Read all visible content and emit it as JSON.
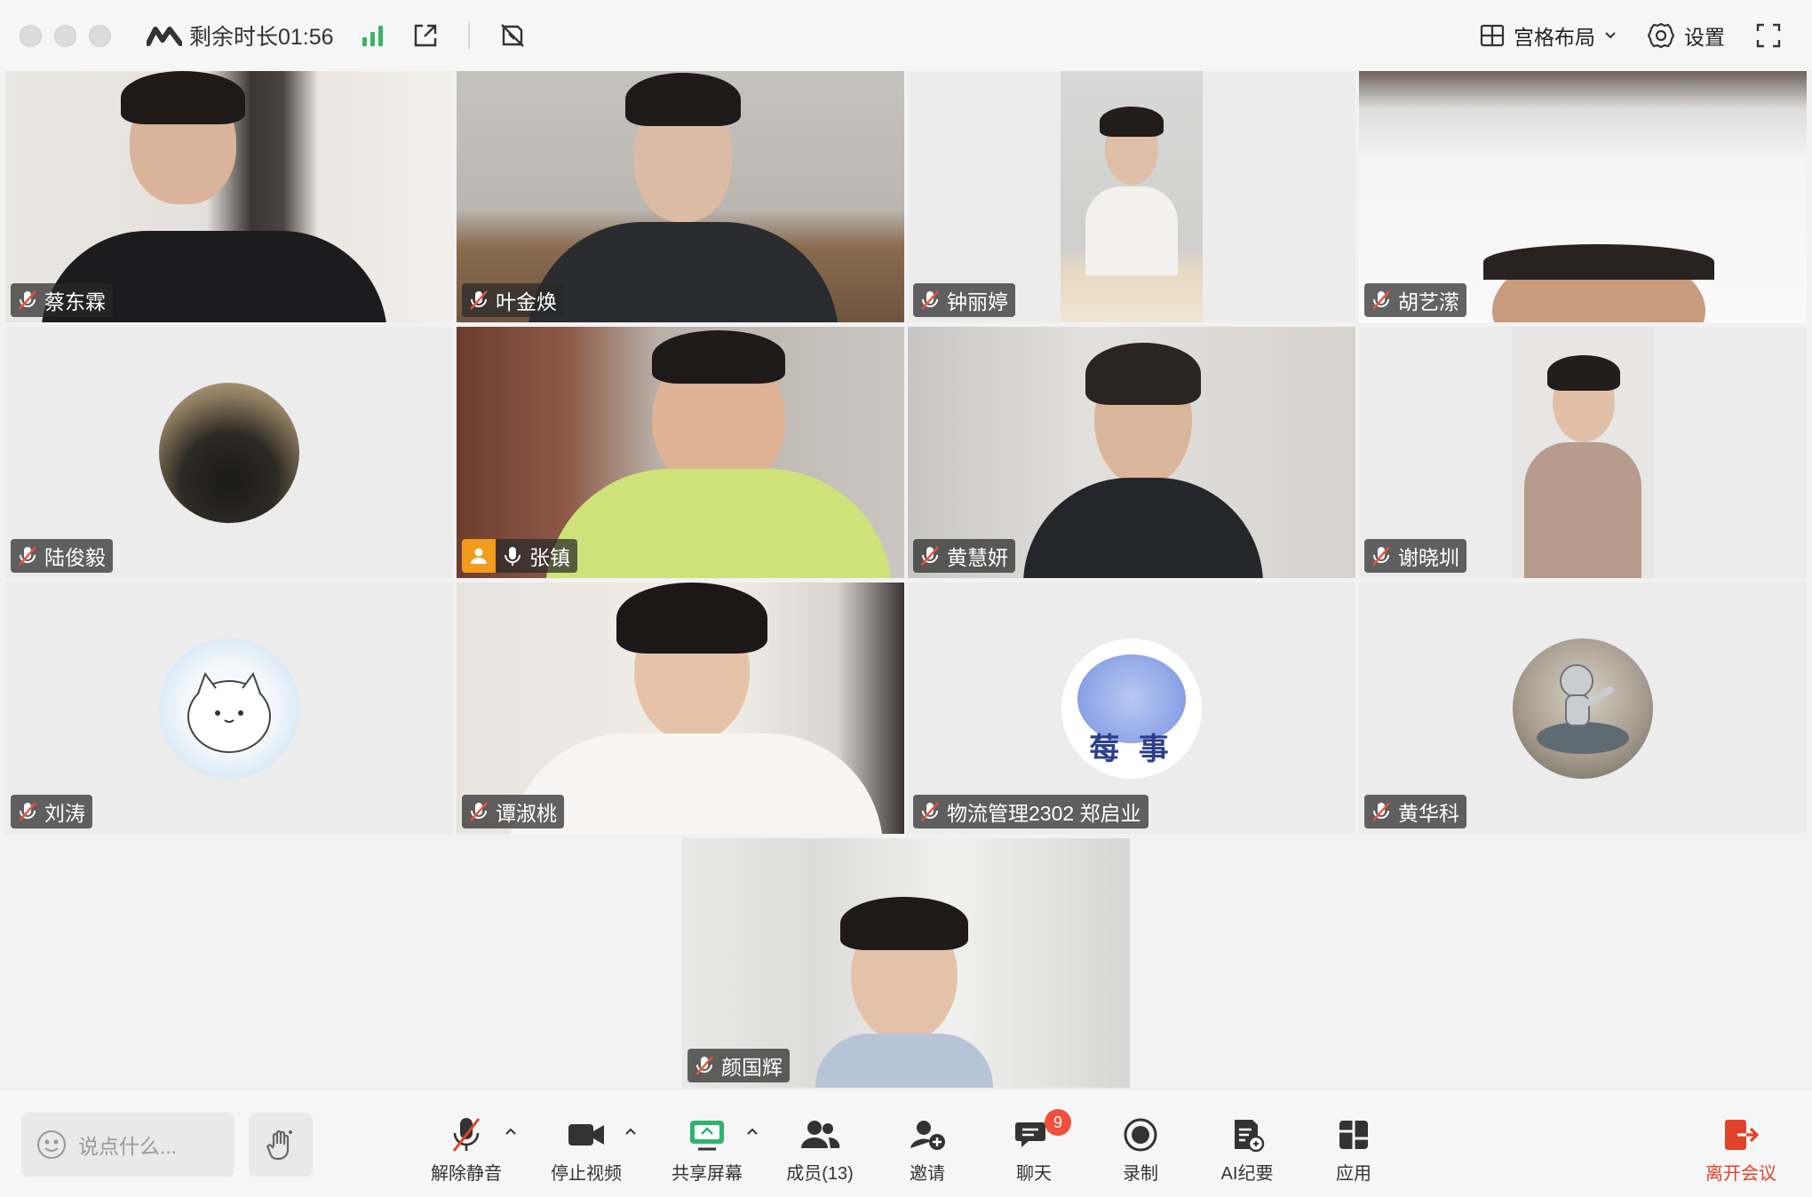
{
  "topbar": {
    "remaining_time": "剩余时长01:56",
    "layout_label": "宫格布局",
    "settings_label": "设置"
  },
  "participants": [
    {
      "name": "蔡东霖",
      "muted": true
    },
    {
      "name": "叶金焕",
      "muted": true
    },
    {
      "name": "钟丽婷",
      "muted": true
    },
    {
      "name": "胡艺潆",
      "muted": true
    },
    {
      "name": "陆俊毅",
      "muted": true
    },
    {
      "name": "张镇",
      "muted": false,
      "host": true
    },
    {
      "name": "黄慧妍",
      "muted": true
    },
    {
      "name": "谢晓圳",
      "muted": true
    },
    {
      "name": "刘涛",
      "muted": true
    },
    {
      "name": "谭淑桃",
      "muted": true
    },
    {
      "name": "物流管理2302 郑启业",
      "muted": true,
      "avatar_text": "莓 事"
    },
    {
      "name": "黄华科",
      "muted": true
    },
    {
      "name": "颜国辉",
      "muted": true
    }
  ],
  "bottombar": {
    "chat_placeholder": "说点什么...",
    "unmute_label": "解除静音",
    "stop_video_label": "停止视频",
    "share_screen_label": "共享屏幕",
    "members_label": "成员(13)",
    "invite_label": "邀请",
    "chat_label": "聊天",
    "chat_badge": "9",
    "record_label": "录制",
    "ai_minutes_label": "AI纪要",
    "apps_label": "应用",
    "leave_label": "离开会议"
  },
  "colors": {
    "signal": "#3cb36b",
    "leave": "#e0432a",
    "badge": "#f0503c",
    "host": "#f39b1f",
    "share_icon": "#2fb36f"
  }
}
